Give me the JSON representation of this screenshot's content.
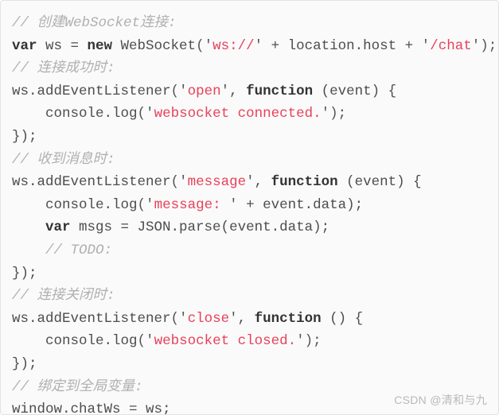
{
  "code_block": {
    "language": "javascript",
    "background_color": "#fafafa",
    "border_color": "#e3e3e3",
    "colors": {
      "comment": "#b0b0b0",
      "keyword": "#333333",
      "string": "#e8415a",
      "plain": "#4d4d4d"
    },
    "lines": [
      {
        "indent": 0,
        "tokens": [
          {
            "t": "cmt",
            "v": "// 创建WebSocket连接:"
          }
        ]
      },
      {
        "indent": 0,
        "tokens": [
          {
            "t": "kw",
            "v": "var"
          },
          {
            "t": "pl",
            "v": " ws = "
          },
          {
            "t": "kw",
            "v": "new"
          },
          {
            "t": "pl",
            "v": " WebSocket"
          },
          {
            "t": "q",
            "v": "('"
          },
          {
            "t": "str",
            "v": "ws://"
          },
          {
            "t": "q",
            "v": "'"
          },
          {
            "t": "pl",
            "v": " + location.host + "
          },
          {
            "t": "q",
            "v": "'"
          },
          {
            "t": "str",
            "v": "/chat"
          },
          {
            "t": "q",
            "v": "'"
          },
          {
            "t": "q",
            "v": ");"
          }
        ]
      },
      {
        "indent": 0,
        "tokens": [
          {
            "t": "cmt",
            "v": "// 连接成功时:"
          }
        ]
      },
      {
        "indent": 0,
        "tokens": [
          {
            "t": "pl",
            "v": "ws.addEventListener"
          },
          {
            "t": "q",
            "v": "('"
          },
          {
            "t": "str",
            "v": "open"
          },
          {
            "t": "q",
            "v": "'"
          },
          {
            "t": "pl",
            "v": ", "
          },
          {
            "t": "kw",
            "v": "function"
          },
          {
            "t": "pl",
            "v": " (event) {"
          }
        ]
      },
      {
        "indent": 1,
        "tokens": [
          {
            "t": "pl",
            "v": "console.log"
          },
          {
            "t": "q",
            "v": "('"
          },
          {
            "t": "str",
            "v": "websocket connected."
          },
          {
            "t": "q",
            "v": "'"
          },
          {
            "t": "q",
            "v": ");"
          }
        ]
      },
      {
        "indent": 0,
        "tokens": [
          {
            "t": "pl",
            "v": "});"
          }
        ]
      },
      {
        "indent": 0,
        "tokens": [
          {
            "t": "cmt",
            "v": "// 收到消息时:"
          }
        ]
      },
      {
        "indent": 0,
        "tokens": [
          {
            "t": "pl",
            "v": "ws.addEventListener"
          },
          {
            "t": "q",
            "v": "('"
          },
          {
            "t": "str",
            "v": "message"
          },
          {
            "t": "q",
            "v": "'"
          },
          {
            "t": "pl",
            "v": ", "
          },
          {
            "t": "kw",
            "v": "function"
          },
          {
            "t": "pl",
            "v": " (event) {"
          }
        ]
      },
      {
        "indent": 1,
        "tokens": [
          {
            "t": "pl",
            "v": "console.log"
          },
          {
            "t": "q",
            "v": "('"
          },
          {
            "t": "str",
            "v": "message: "
          },
          {
            "t": "q",
            "v": "'"
          },
          {
            "t": "pl",
            "v": " + event.data);"
          }
        ]
      },
      {
        "indent": 1,
        "tokens": [
          {
            "t": "kw",
            "v": "var"
          },
          {
            "t": "pl",
            "v": " msgs = JSON.parse(event.data);"
          }
        ]
      },
      {
        "indent": 1,
        "tokens": [
          {
            "t": "cmt",
            "v": "// TODO:"
          }
        ]
      },
      {
        "indent": 0,
        "tokens": [
          {
            "t": "pl",
            "v": "});"
          }
        ]
      },
      {
        "indent": 0,
        "tokens": [
          {
            "t": "cmt",
            "v": "// 连接关闭时:"
          }
        ]
      },
      {
        "indent": 0,
        "tokens": [
          {
            "t": "pl",
            "v": "ws.addEventListener"
          },
          {
            "t": "q",
            "v": "('"
          },
          {
            "t": "str",
            "v": "close"
          },
          {
            "t": "q",
            "v": "'"
          },
          {
            "t": "pl",
            "v": ", "
          },
          {
            "t": "kw",
            "v": "function"
          },
          {
            "t": "pl",
            "v": " () {"
          }
        ]
      },
      {
        "indent": 1,
        "tokens": [
          {
            "t": "pl",
            "v": "console.log"
          },
          {
            "t": "q",
            "v": "('"
          },
          {
            "t": "str",
            "v": "websocket closed."
          },
          {
            "t": "q",
            "v": "'"
          },
          {
            "t": "q",
            "v": ");"
          }
        ]
      },
      {
        "indent": 0,
        "tokens": [
          {
            "t": "pl",
            "v": "});"
          }
        ]
      },
      {
        "indent": 0,
        "tokens": [
          {
            "t": "cmt",
            "v": "// 绑定到全局变量:"
          }
        ]
      },
      {
        "indent": 0,
        "tokens": [
          {
            "t": "pl",
            "v": "window.chatWs = ws;"
          }
        ]
      }
    ]
  },
  "watermark": {
    "text": "CSDN @清和与九"
  }
}
